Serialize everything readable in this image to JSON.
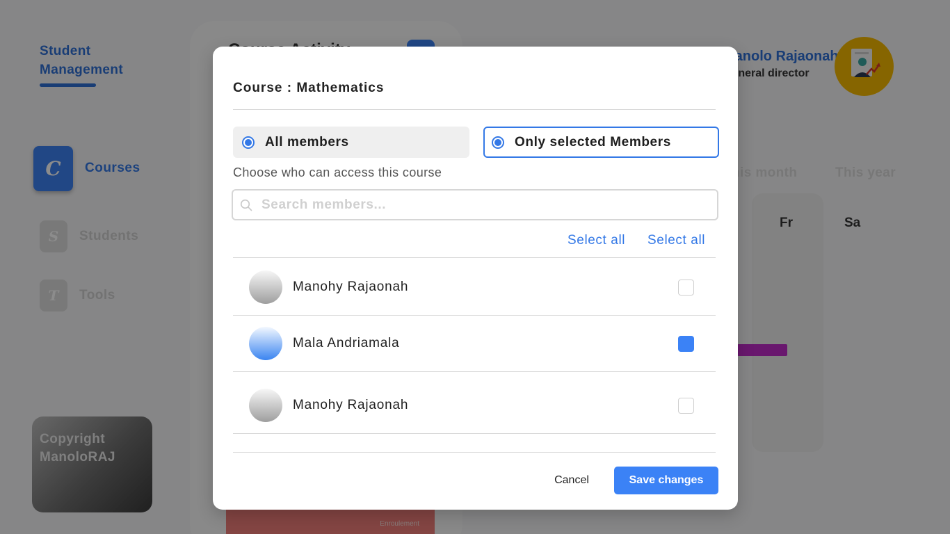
{
  "background": {
    "brand": {
      "line1": "Student",
      "line2": "Management"
    },
    "nav": [
      {
        "label": "Courses",
        "letter": "C"
      },
      {
        "label": "Students",
        "letter": "S"
      },
      {
        "label": "Tools",
        "letter": "T"
      }
    ],
    "copyright": {
      "line1": "Copyright",
      "line2": "ManoloRAJ"
    },
    "panel_title": "Course Activity",
    "card_footer": "Enroulement",
    "profile": {
      "name": "Manolo Rajaonah",
      "role": "General director"
    },
    "tabs": [
      "This month",
      "This year"
    ],
    "days": [
      "Fr",
      "Sa"
    ]
  },
  "modal": {
    "title": "Course : Mathematics",
    "options": {
      "all": "All members",
      "selected": "Only selected Members"
    },
    "hint": "Choose who can access this course",
    "search": {
      "placeholder": "Search members..."
    },
    "select_links": [
      "Select all",
      "Select all"
    ],
    "members": [
      {
        "name": "Manohy Rajaonah",
        "checked": false,
        "avatar": "grey"
      },
      {
        "name": "Mala Andriamala",
        "checked": true,
        "avatar": "blue"
      },
      {
        "name": "Manohy Rajaonah",
        "checked": false,
        "avatar": "grey"
      }
    ],
    "cancel_label": "Cancel",
    "save_label": "Save changes"
  },
  "colors": {
    "accent": "#3b82f6",
    "brand": "#2f6fd6",
    "overlay": "rgba(0,0,0,0.45)"
  }
}
